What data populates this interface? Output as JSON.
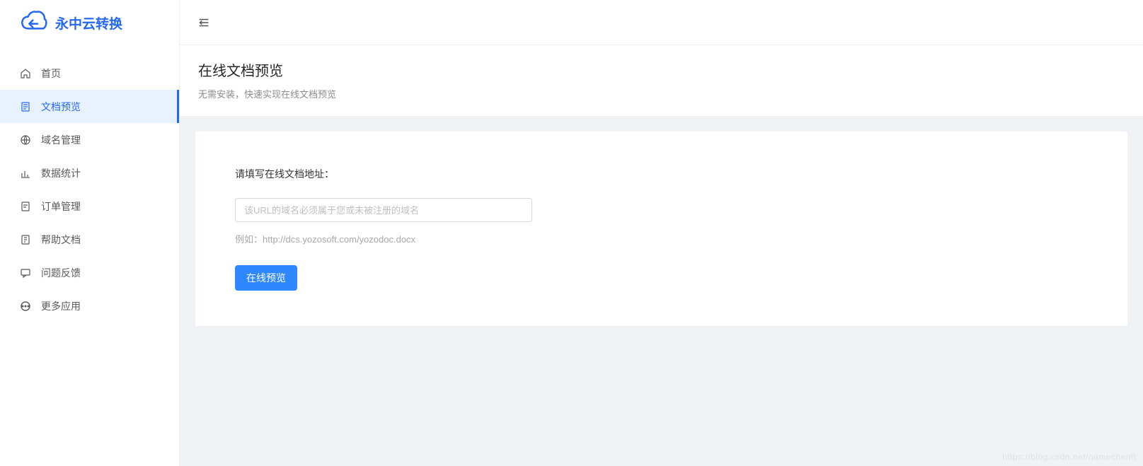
{
  "brand": {
    "name": "永中云转换"
  },
  "sidebar": {
    "items": [
      {
        "label": "首页",
        "icon": "home-icon"
      },
      {
        "label": "文档预览",
        "icon": "doc-preview-icon"
      },
      {
        "label": "域名管理",
        "icon": "domain-icon"
      },
      {
        "label": "数据统计",
        "icon": "stats-icon"
      },
      {
        "label": "订单管理",
        "icon": "order-icon"
      },
      {
        "label": "帮助文档",
        "icon": "help-doc-icon"
      },
      {
        "label": "问题反馈",
        "icon": "feedback-icon"
      },
      {
        "label": "更多应用",
        "icon": "more-apps-icon"
      }
    ],
    "activeIndex": 1
  },
  "page": {
    "title": "在线文档预览",
    "subtitle": "无需安装，快速实现在线文档预览"
  },
  "form": {
    "label": "请填写在线文档地址：",
    "url_value": "",
    "url_placeholder": "该URL的域名必须属于您或未被注册的域名",
    "hint": "例如：http://dcs.yozosoft.com/yozodoc.docx",
    "submit_label": "在线预览"
  },
  "watermark": "https://blog.csdn.net/namechenfl",
  "colors": {
    "primary": "#2468f2",
    "button": "#2f88ff",
    "activeBg": "#e8f2ff",
    "body": "#f0f2f5"
  }
}
